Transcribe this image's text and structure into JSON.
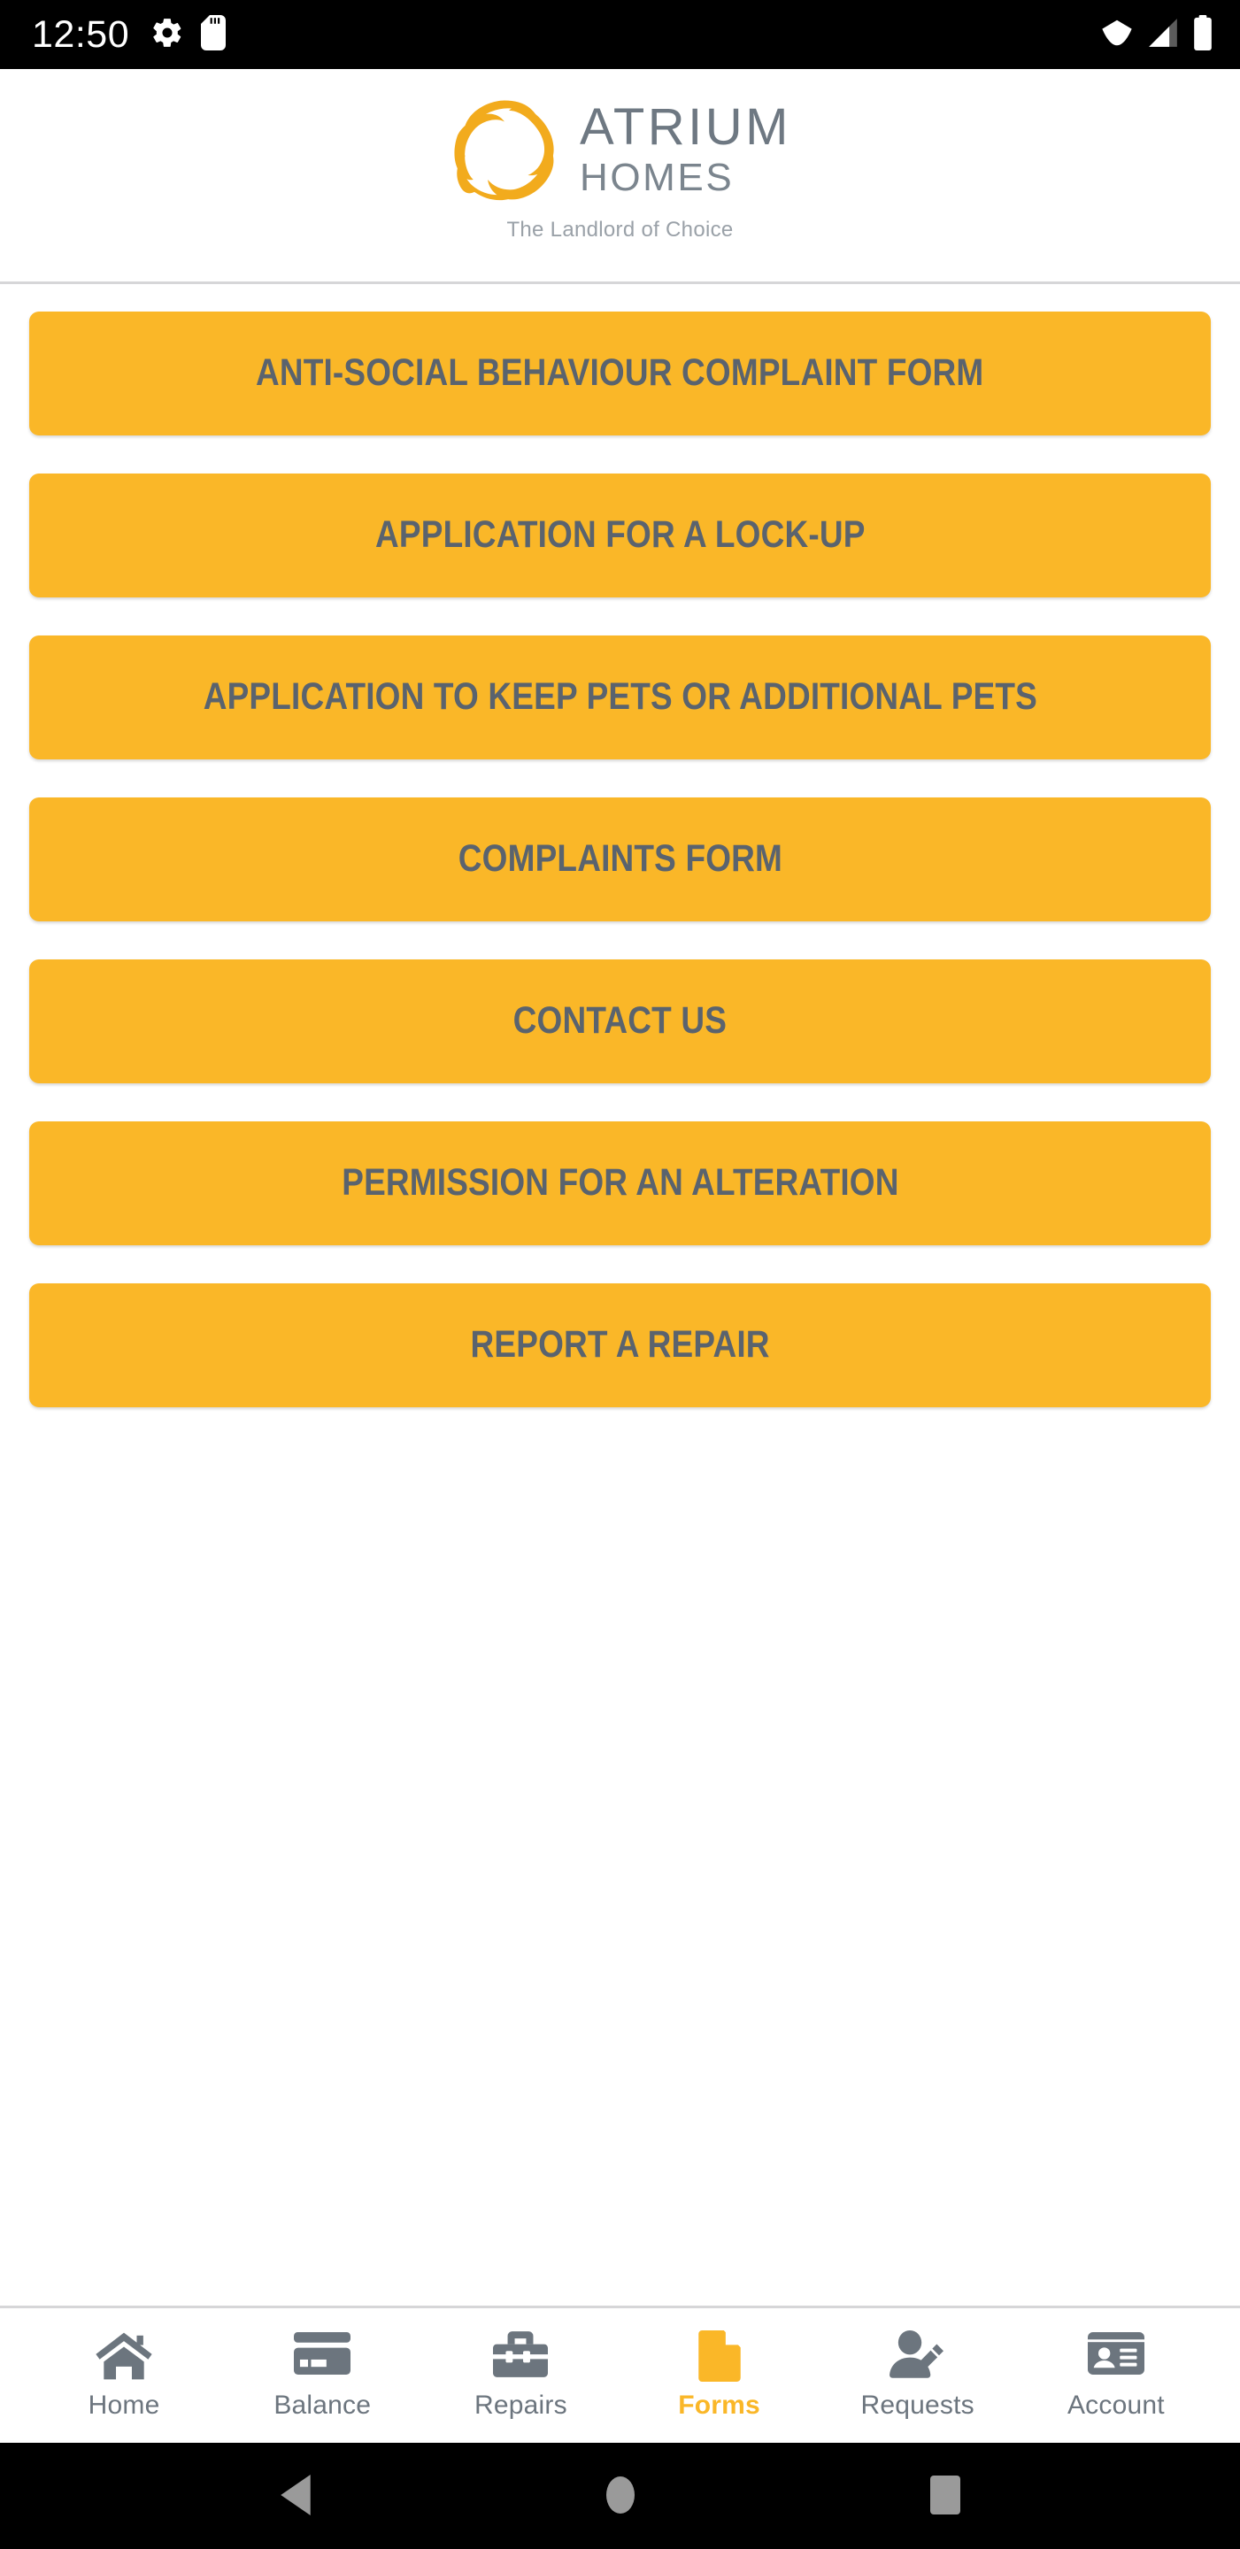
{
  "status_bar": {
    "time": "12:50",
    "left_icons": [
      "gear-icon",
      "sd-card-icon"
    ],
    "right_icons": [
      "wifi-icon",
      "cellular-signal-icon",
      "battery-icon"
    ],
    "background": "#000000"
  },
  "header": {
    "brand_primary": "ATRIUM",
    "brand_secondary": "HOMES",
    "tagline": "The Landlord of Choice",
    "logo_icon": "atrium-swirl-logo",
    "logo_color": "#f2ab1d",
    "text_color": "#6e7882"
  },
  "theme": {
    "accent": "#fab728",
    "button_text": "#5a636e",
    "icon_gray": "#6c757e",
    "divider": "#d6d6d8",
    "page_background": "#ffffff"
  },
  "main": {
    "form_buttons": [
      {
        "label": "ANTI-SOCIAL BEHAVIOUR COMPLAINT FORM"
      },
      {
        "label": "APPLICATION FOR A LOCK-UP"
      },
      {
        "label": "APPLICATION TO KEEP PETS OR ADDITIONAL PETS"
      },
      {
        "label": "COMPLAINTS FORM"
      },
      {
        "label": "CONTACT US"
      },
      {
        "label": "PERMISSION FOR AN ALTERATION"
      },
      {
        "label": "REPORT A REPAIR"
      }
    ]
  },
  "tab_bar": {
    "active_index": 3,
    "items": [
      {
        "label": "Home",
        "icon": "house-icon"
      },
      {
        "label": "Balance",
        "icon": "credit-card-icon"
      },
      {
        "label": "Repairs",
        "icon": "toolbox-icon"
      },
      {
        "label": "Forms",
        "icon": "document-page-icon"
      },
      {
        "label": "Requests",
        "icon": "person-pencil-icon"
      },
      {
        "label": "Account",
        "icon": "id-card-icon"
      }
    ]
  },
  "android_nav": {
    "buttons": [
      {
        "name": "back-button",
        "icon": "triangle-left-icon"
      },
      {
        "name": "home-button",
        "icon": "circle-icon"
      },
      {
        "name": "recents-button",
        "icon": "square-icon"
      }
    ]
  }
}
